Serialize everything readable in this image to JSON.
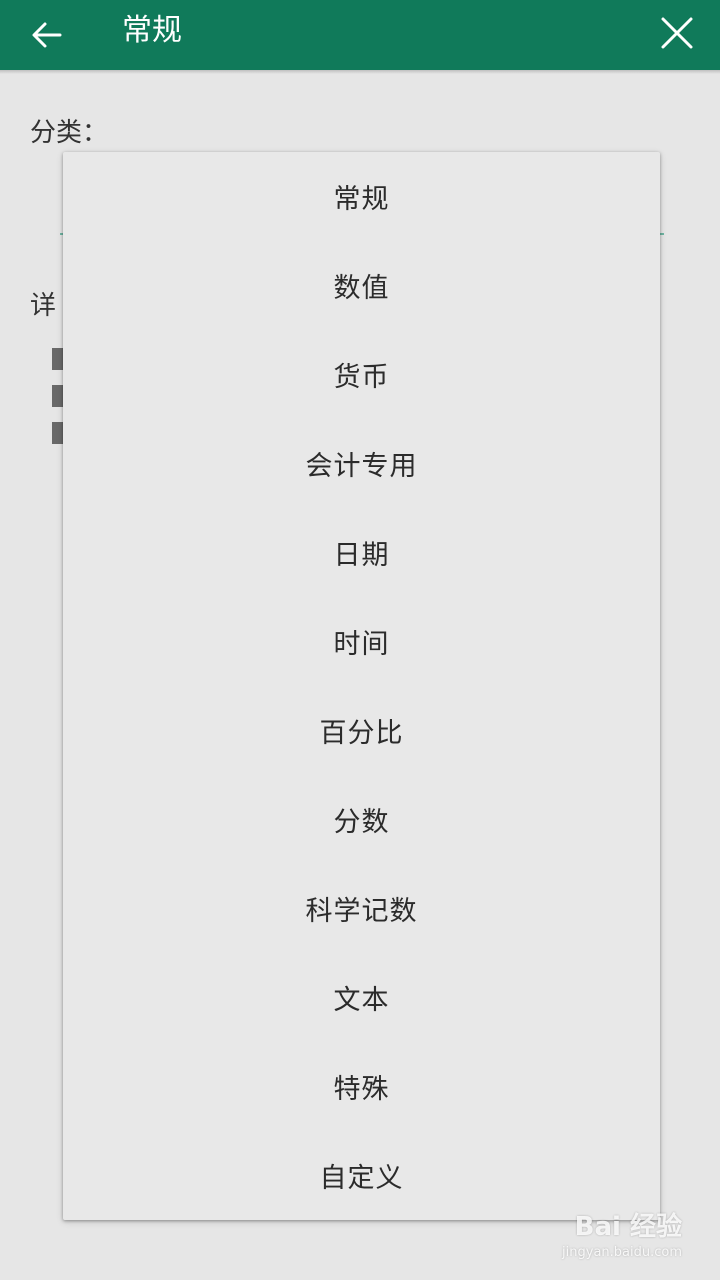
{
  "appbar": {
    "title": "常规",
    "back_icon": "arrow-left-icon",
    "close_icon": "close-icon",
    "color": "#107a5a"
  },
  "form": {
    "category_label": "分类：",
    "details_label": "详"
  },
  "dropdown": {
    "items": [
      {
        "label": "常规"
      },
      {
        "label": "数值"
      },
      {
        "label": "货币"
      },
      {
        "label": "会计专用"
      },
      {
        "label": "日期"
      },
      {
        "label": "时间"
      },
      {
        "label": "百分比"
      },
      {
        "label": "分数"
      },
      {
        "label": "科学记数"
      },
      {
        "label": "文本"
      },
      {
        "label": "特殊"
      },
      {
        "label": "自定义"
      }
    ]
  },
  "watermark": {
    "logo_text": "Bai 经验",
    "url": "jingyan.baidu.com"
  }
}
